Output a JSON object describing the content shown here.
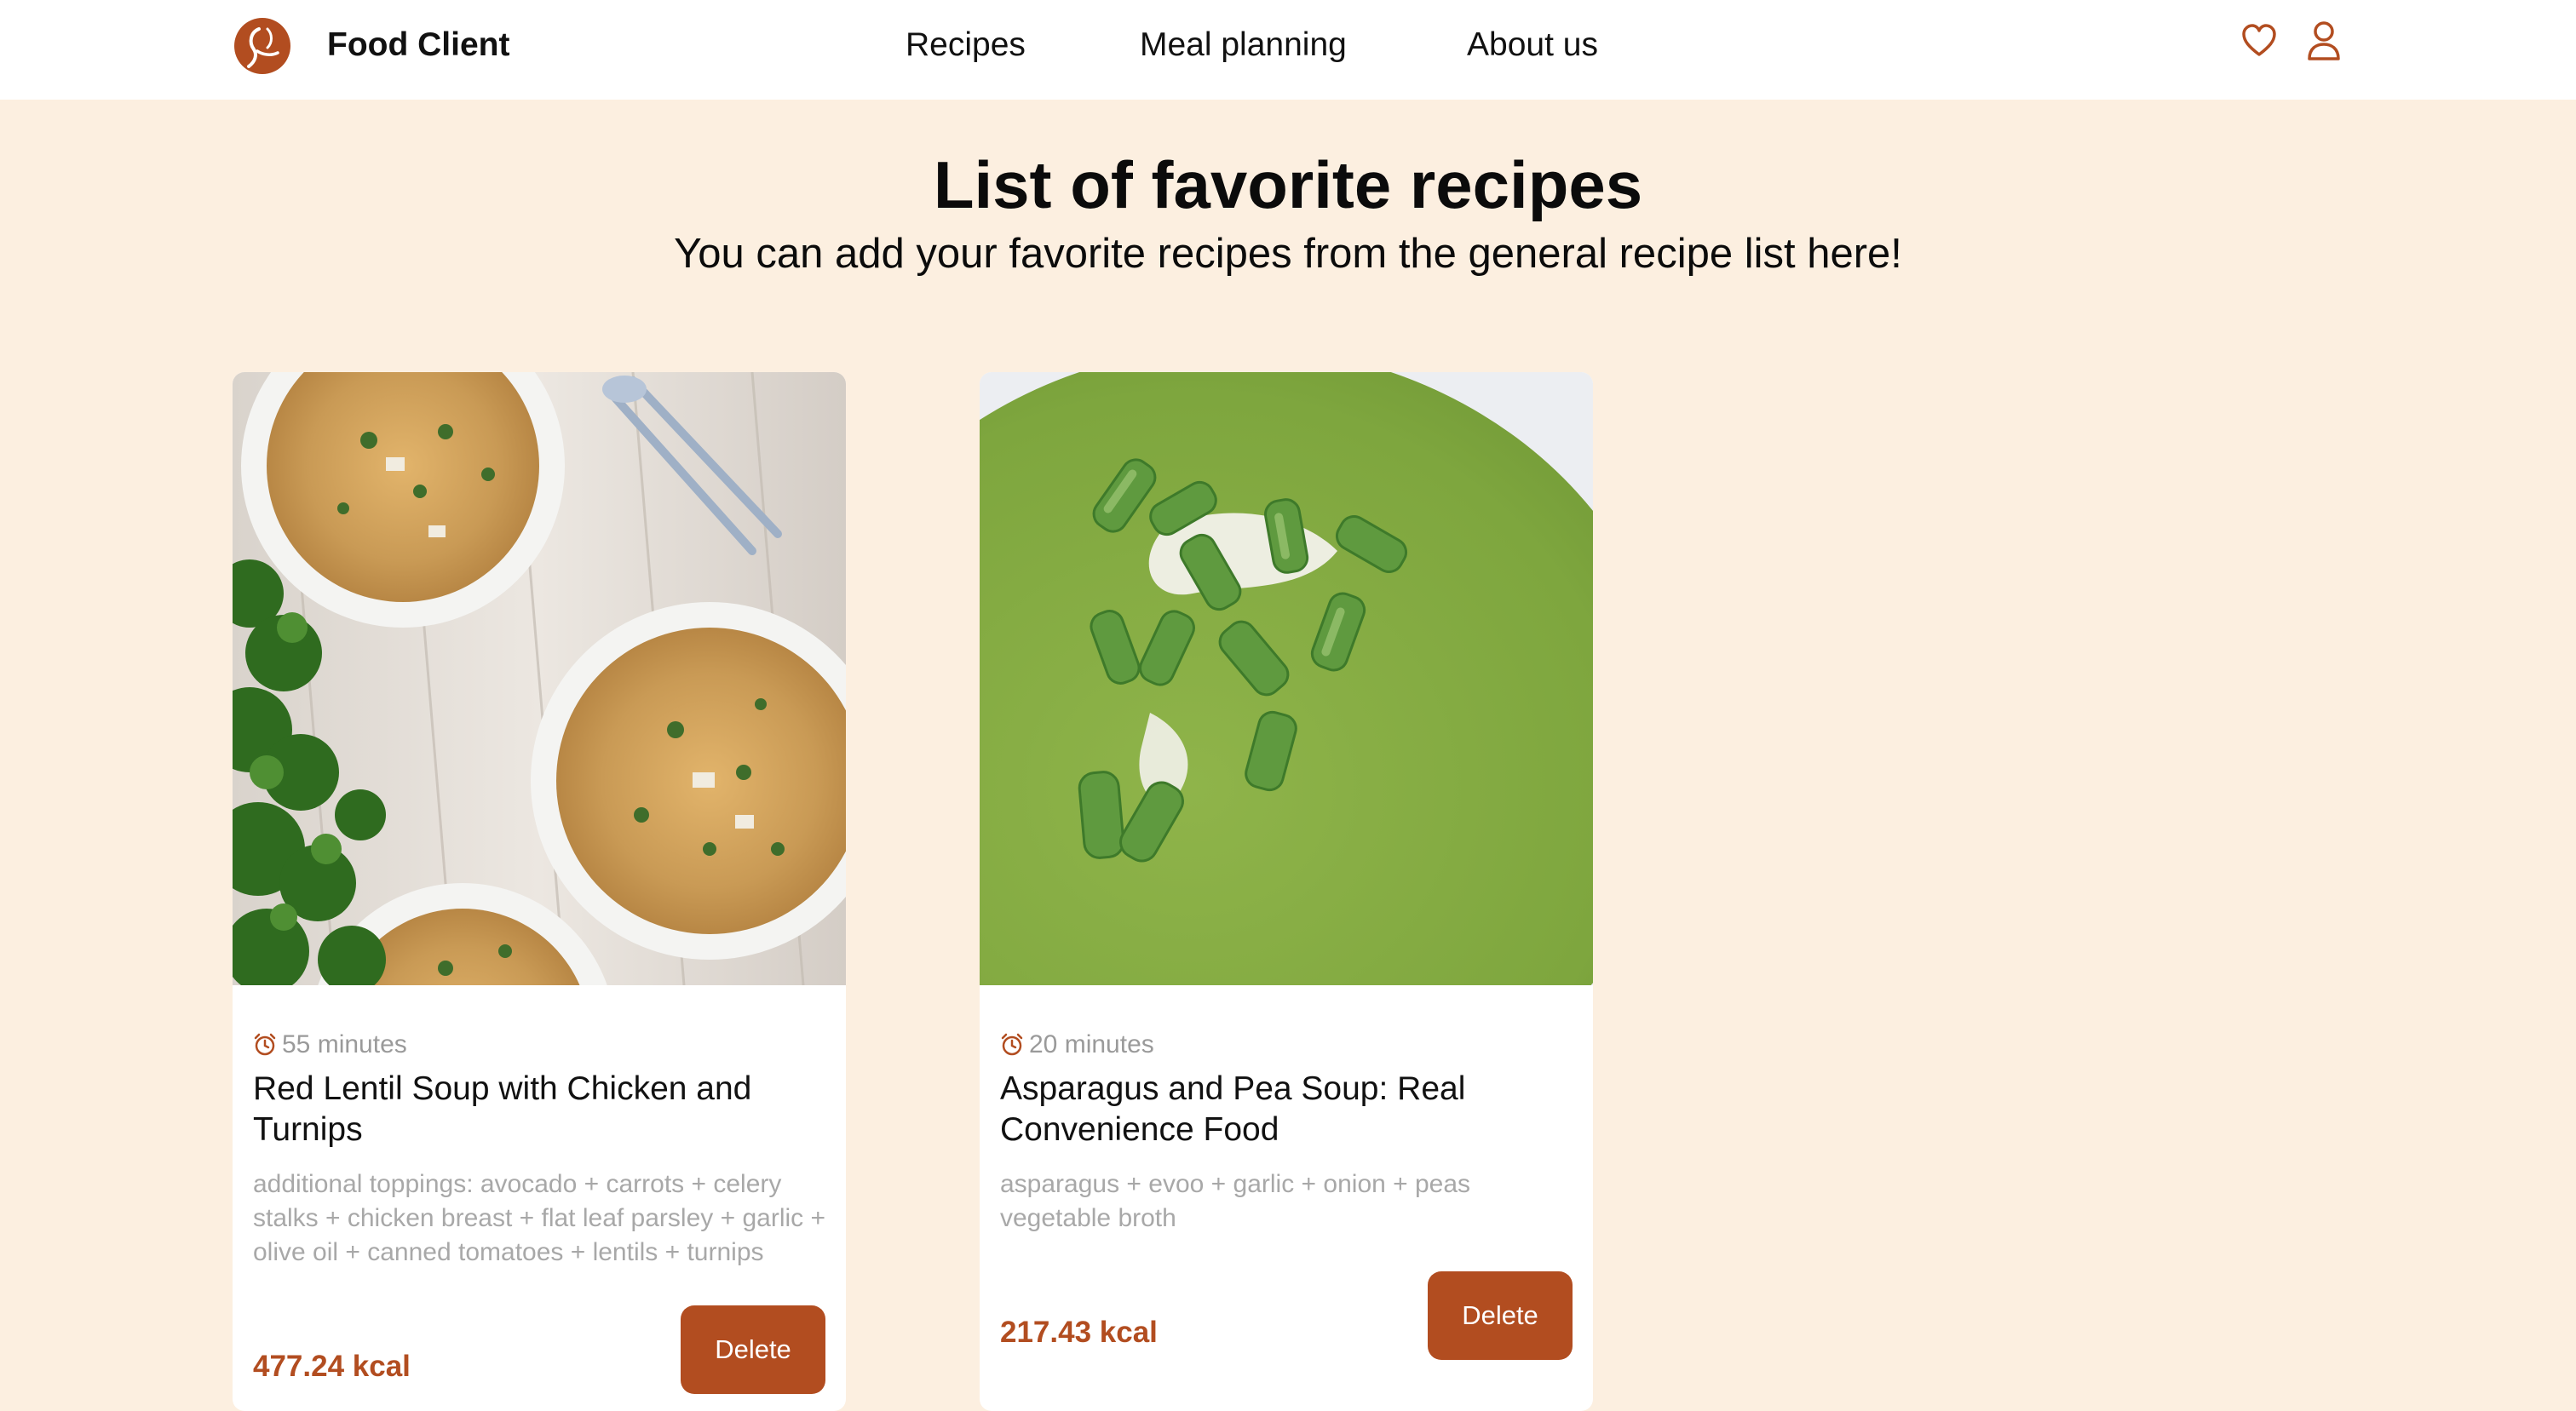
{
  "header": {
    "brand": "Food Client",
    "nav": [
      "Recipes",
      "Meal planning",
      "About us"
    ],
    "icons": [
      "heart-icon",
      "user-icon"
    ],
    "accent": "#b24d20"
  },
  "page": {
    "title": "List of favorite recipes",
    "subtitle": "You can add your favorite recipes from the general recipe list here!",
    "background": "#fcefe0"
  },
  "recipes": [
    {
      "time": "55 minutes",
      "title": "Red Lentil Soup with Chicken and Turnips",
      "ingredients": "additional toppings: avocado + carrots + celery stalks + chicken breast + flat leaf parsley + garlic + olive oil + canned tomatoes + lentils + turnips",
      "kcal": "477.24 kcal",
      "action": "Delete"
    },
    {
      "time": "20 minutes",
      "title": "Asparagus and Pea Soup: Real Convenience Food",
      "ingredients": "asparagus + evoo + garlic + onion + peas vegetable broth",
      "kcal": "217.43 kcal",
      "action": "Delete"
    }
  ]
}
